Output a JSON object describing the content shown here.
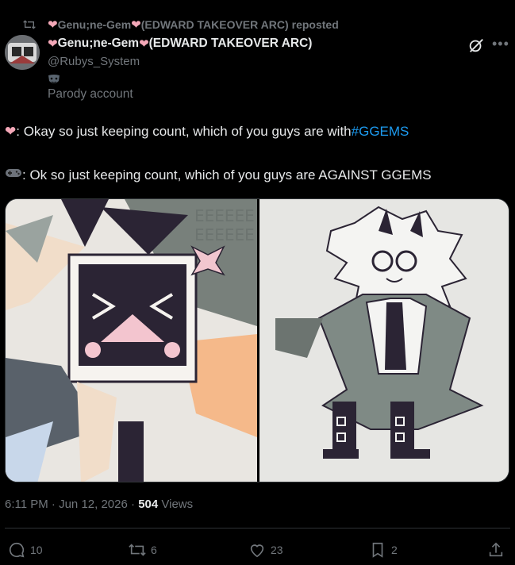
{
  "repost": {
    "display_name": "Genu;ne-Gem",
    "arc": "(EDWARD TAKEOVER ARC)",
    "suffix": "reposted"
  },
  "author": {
    "display_name": "Genu;ne-Gem",
    "arc": "(EDWARD TAKEOVER ARC)",
    "handle": "@Rubys_System",
    "label": "Parody account"
  },
  "tweet": {
    "line1_prefix": ": Okay so just keeping count, which of you guys are with ",
    "line1_hashtag": "#GGEMS",
    "line2": ": Ok so just keeping count, which of you guys are AGAINST GGEMS"
  },
  "meta": {
    "time": "6:11 PM",
    "date": "Jun 12, 2026",
    "views_count": "504",
    "views_label": "Views"
  },
  "actions": {
    "replies": "10",
    "reposts": "6",
    "likes": "23",
    "bookmarks": "2"
  },
  "colors": {
    "background": "#000000",
    "text": "#e7e9ea",
    "muted": "#71767b",
    "link": "#1d9bf0",
    "heart": "#f4a8b8"
  }
}
